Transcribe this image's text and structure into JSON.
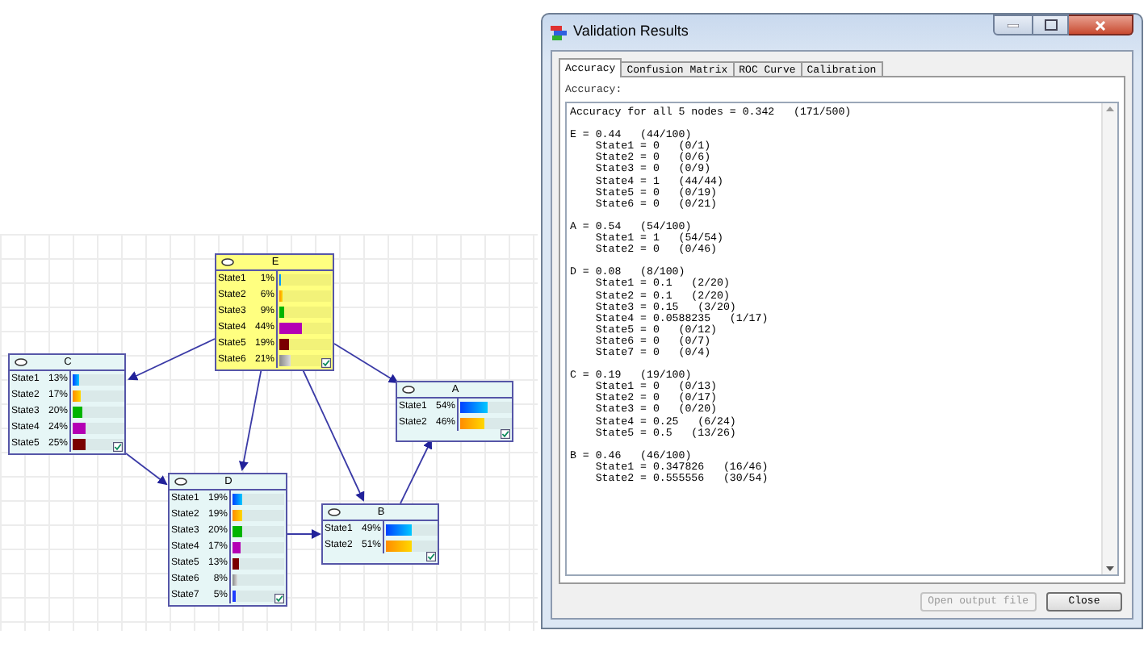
{
  "canvas": {
    "nodes": [
      {
        "name": "E",
        "selected": true,
        "states": [
          {
            "label": "State1",
            "value": "1%",
            "level": 0.01
          },
          {
            "label": "State2",
            "value": "6%",
            "level": 0.06
          },
          {
            "label": "State3",
            "value": "9%",
            "level": 0.09
          },
          {
            "label": "State4",
            "value": "44%",
            "level": 0.44
          },
          {
            "label": "State5",
            "value": "19%",
            "level": 0.19
          },
          {
            "label": "State6",
            "value": "21%",
            "level": 0.21
          }
        ]
      },
      {
        "name": "C",
        "selected": false,
        "states": [
          {
            "label": "State1",
            "value": "13%",
            "level": 0.13
          },
          {
            "label": "State2",
            "value": "17%",
            "level": 0.17
          },
          {
            "label": "State3",
            "value": "20%",
            "level": 0.2
          },
          {
            "label": "State4",
            "value": "24%",
            "level": 0.24
          },
          {
            "label": "State5",
            "value": "25%",
            "level": 0.25
          }
        ]
      },
      {
        "name": "A",
        "selected": false,
        "states": [
          {
            "label": "State1",
            "value": "54%",
            "level": 0.54
          },
          {
            "label": "State2",
            "value": "46%",
            "level": 0.46
          }
        ]
      },
      {
        "name": "D",
        "selected": false,
        "states": [
          {
            "label": "State1",
            "value": "19%",
            "level": 0.19
          },
          {
            "label": "State2",
            "value": "19%",
            "level": 0.19
          },
          {
            "label": "State3",
            "value": "20%",
            "level": 0.2
          },
          {
            "label": "State4",
            "value": "17%",
            "level": 0.17
          },
          {
            "label": "State5",
            "value": "13%",
            "level": 0.13
          },
          {
            "label": "State6",
            "value": "8%",
            "level": 0.08
          },
          {
            "label": "State7",
            "value": "5%",
            "level": 0.05
          }
        ]
      },
      {
        "name": "B",
        "selected": false,
        "states": [
          {
            "label": "State1",
            "value": "49%",
            "level": 0.49
          },
          {
            "label": "State2",
            "value": "51%",
            "level": 0.51
          }
        ]
      }
    ]
  },
  "window": {
    "title": "Validation Results",
    "tabs": [
      {
        "label": "Accuracy",
        "selected": true
      },
      {
        "label": "Confusion Matrix",
        "selected": false
      },
      {
        "label": "ROC Curve",
        "selected": false
      },
      {
        "label": "Calibration",
        "selected": false
      }
    ],
    "field_label": "Accuracy:",
    "report": "Accuracy for all 5 nodes = 0.342   (171/500)\n\nE = 0.44   (44/100)\n    State1 = 0   (0/1)\n    State2 = 0   (0/6)\n    State3 = 0   (0/9)\n    State4 = 1   (44/44)\n    State5 = 0   (0/19)\n    State6 = 0   (0/21)\n\nA = 0.54   (54/100)\n    State1 = 1   (54/54)\n    State2 = 0   (0/46)\n\nD = 0.08   (8/100)\n    State1 = 0.1   (2/20)\n    State2 = 0.1   (2/20)\n    State3 = 0.15   (3/20)\n    State4 = 0.0588235   (1/17)\n    State5 = 0   (0/12)\n    State6 = 0   (0/7)\n    State7 = 0   (0/4)\n\nC = 0.19   (19/100)\n    State1 = 0   (0/13)\n    State2 = 0   (0/17)\n    State3 = 0   (0/20)\n    State4 = 0.25   (6/24)\n    State5 = 0.5   (13/26)\n\nB = 0.46   (46/100)\n    State1 = 0.347826   (16/46)\n    State2 = 0.555556   (30/54)",
    "buttons": [
      {
        "label": "Open output file",
        "disabled": true
      },
      {
        "label": "Close",
        "disabled": false
      }
    ]
  }
}
